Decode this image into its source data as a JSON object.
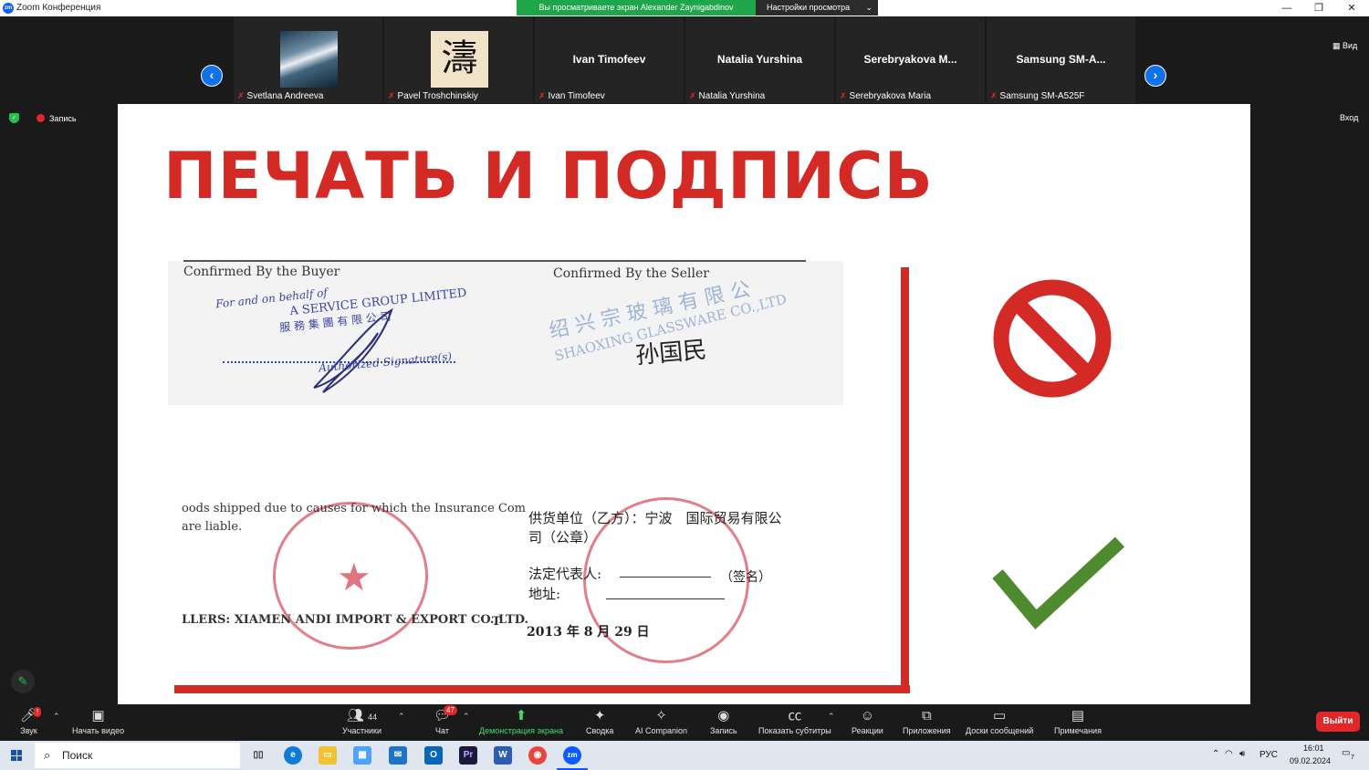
{
  "window": {
    "title": "Zoom Конференция",
    "logo": "zm"
  },
  "share_banner": "Вы просматриваете экран Alexander Zaynigabdinov",
  "view_settings": "Настройки просмотра",
  "gallery": {
    "prev_icon": "‹",
    "next_icon": "›",
    "tiles": [
      {
        "big_name": "",
        "caption": "Svetlana Andreeva",
        "thumb": "sea"
      },
      {
        "big_name": "",
        "caption": "Pavel Troshchinskiy",
        "thumb": "calligraphy",
        "glyph": "濤"
      },
      {
        "big_name": "Ivan Timofeev",
        "caption": "Ivan Timofeev"
      },
      {
        "big_name": "Natalia Yurshina",
        "caption": "Natalia Yurshina"
      },
      {
        "big_name": "Serebryakova  M...",
        "caption": "Serebryakova Maria"
      },
      {
        "big_name": "Samsung  SM-A...",
        "caption": "Samsung SM-A525F"
      }
    ]
  },
  "view_button": "Вид",
  "enter_button": "Вход",
  "recording_label": "Запись",
  "slide": {
    "title": "ПЕЧАТЬ И ПОДПИСЬ",
    "doc": {
      "buyer_heading": "Confirmed By the Buyer",
      "seller_heading": "Confirmed By the Seller",
      "buyer_stamp_line1": "For  and  on  behalf  of",
      "buyer_stamp_line2": "A  SERVICE  GROUP  LIMITED",
      "buyer_stamp_line3": "服 務 集 團 有 限 公 司",
      "buyer_signature_label": "Authorized  Signature(s)",
      "seller_stamp_faint": "绍 兴 宗 玻 璃 有 限 公",
      "seller_stamp_faint2": "SHAOXING GLASSWARE CO.,LTD",
      "seller_signature": "孙国民",
      "lower_line1": "oods shipped due to causes for which the Insurance Com",
      "lower_line2": "are liable.",
      "supplier_line1": "供货单位（乙方）：宁波　国际贸易有限公",
      "supplier_line2": "司（公章）",
      "rep_label": "法定代表人:",
      "rep_sign": "（签名）",
      "address_label": "地址:",
      "sellers_line": "LLERS:  XIAMEN ANDI IMPORT & EXPORT CO.,LTD.",
      "sellers_tail": "T",
      "date_line": "2013 年 8 月 29 日"
    }
  },
  "toolbar": {
    "audio": "Звук",
    "video": "Начать видео",
    "participants": "Участники",
    "participants_count": "44",
    "chat": "Чат",
    "chat_badge": "47",
    "share": "Демонстрация экрана",
    "summary": "Сводка",
    "ai": "AI Companion",
    "record": "Запись",
    "captions": "Показать субтитры",
    "reactions": "Реакции",
    "apps": "Приложения",
    "whiteboards": "Доски сообщений",
    "notes": "Примечания",
    "leave": "Выйти"
  },
  "taskbar": {
    "search": "Поиск",
    "lang": "РУС",
    "time": "16:01",
    "date": "09.02.2024",
    "notif_count": "7"
  },
  "colors": {
    "accent_red": "#d42a26",
    "zoom_blue": "#0e72ed",
    "share_green": "#1fa54a",
    "check_green": "#4e8b2e"
  }
}
